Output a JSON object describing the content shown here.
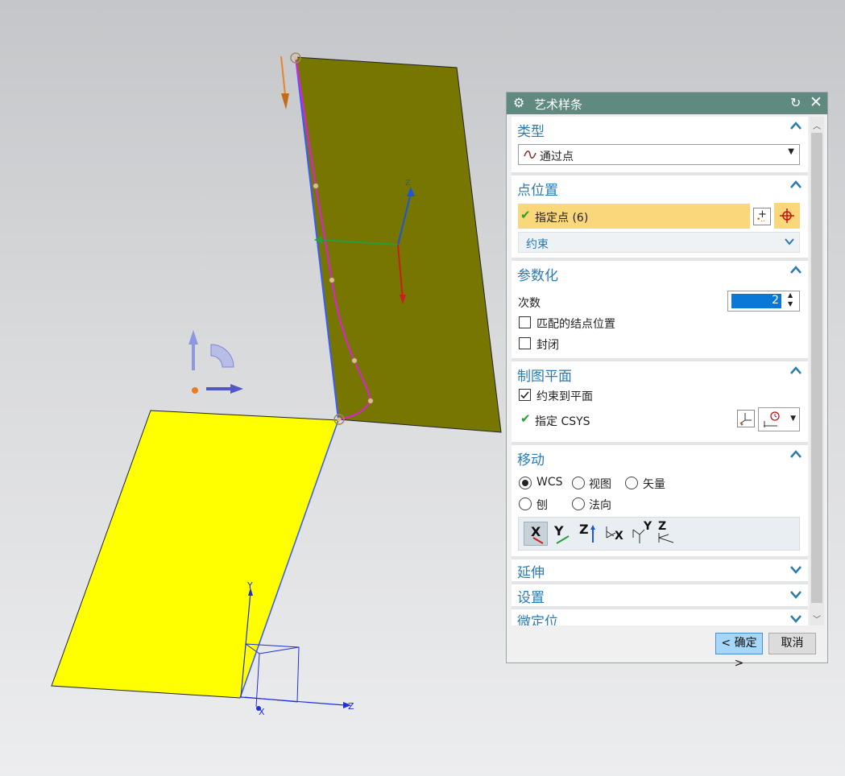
{
  "dialog": {
    "title": "艺术样条",
    "sections": {
      "type": {
        "title": "类型",
        "selected": "通过点"
      },
      "point_position": {
        "title": "点位置",
        "specify_point": "指定点 (6)",
        "constraint": "约束"
      },
      "parameterization": {
        "title": "参数化",
        "degree_label": "次数",
        "degree_value": "2",
        "match_knots": "匹配的结点位置",
        "closed": "封闭"
      },
      "drawing_plane": {
        "title": "制图平面",
        "constrain_to_plane": "约束到平面",
        "specify_csys": "指定 CSYS"
      },
      "move": {
        "title": "移动",
        "radio_wcs": "WCS",
        "radio_view": "视图",
        "radio_vector": "矢量",
        "radio_plane": "刨",
        "radio_normal": "法向",
        "axis_buttons": [
          "X",
          "Y",
          "Z",
          "X",
          "Y",
          "Z"
        ]
      },
      "extend": {
        "title": "延伸"
      },
      "settings": {
        "title": "设置"
      },
      "fine_position": {
        "title": "微定位"
      }
    },
    "ok_label": "< 确定 >",
    "cancel_label": "取消"
  },
  "viewport": {
    "axis_labels": {
      "wcs_z": "Z",
      "csys_y": "Y",
      "csys_z": "Z",
      "csys_x": "X"
    }
  },
  "colors": {
    "title_bar": "#5f8a80",
    "accent_text": "#2a7bb5",
    "highlight_row": "#fad77a",
    "olive_plane": "#767600",
    "yellow_plane": "#ffff00",
    "spline": "#e01ee0"
  }
}
